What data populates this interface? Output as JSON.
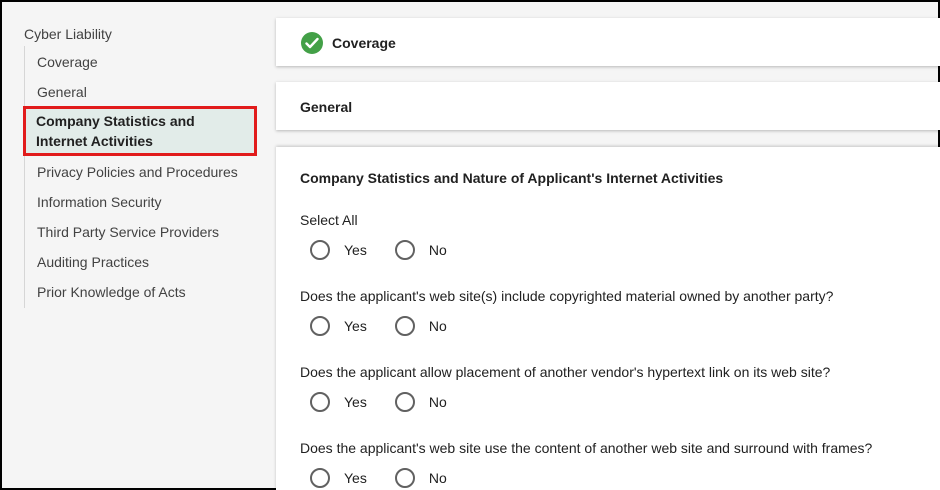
{
  "sidebar": {
    "title": "Cyber Liability",
    "items": [
      {
        "label": "Coverage"
      },
      {
        "label": "General"
      },
      {
        "label": "Company Statistics and Internet Activities"
      },
      {
        "label": "Privacy Policies and Procedures"
      },
      {
        "label": "Information Security"
      },
      {
        "label": "Third Party Service Providers"
      },
      {
        "label": "Auditing Practices"
      },
      {
        "label": "Prior Knowledge of Acts"
      }
    ],
    "active_index": 2
  },
  "coverage_card": {
    "title": "Coverage",
    "status_icon": "check-circle-icon",
    "status_color": "#43a047"
  },
  "general_card": {
    "title": "General"
  },
  "section": {
    "title": "Company Statistics and Nature of Applicant's Internet Activities",
    "select_all_label": "Select All",
    "yes_label": "Yes",
    "no_label": "No",
    "questions": [
      {
        "text": "Does the applicant's web site(s) include copyrighted material owned by another party?"
      },
      {
        "text": "Does the applicant allow placement of another vendor's hypertext link on its web site?"
      },
      {
        "text": "Does the applicant's web site use the content of another web site and surround with frames?"
      }
    ]
  },
  "highlight_color": "#e11b1b"
}
